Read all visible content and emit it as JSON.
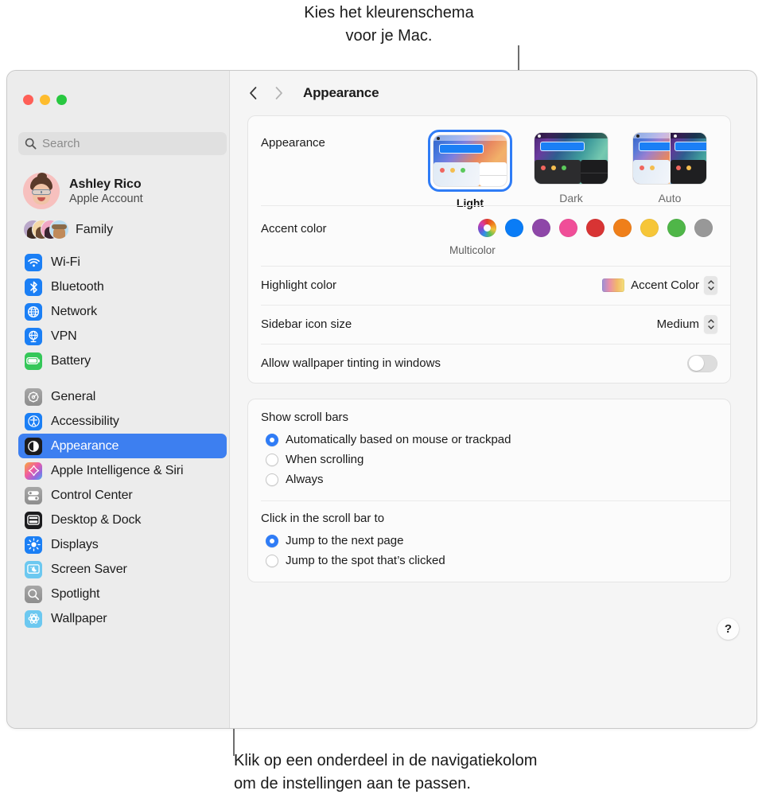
{
  "callouts": {
    "top": "Kies het kleurenschema\nvoor je Mac.",
    "bottom": "Klik op een onderdeel in de navigatiekolom\nom de instellingen aan te passen."
  },
  "window": {
    "traffic_lights": {
      "close": "close-button",
      "minimize": "minimize-button",
      "zoom": "zoom-button"
    }
  },
  "sidebar": {
    "search": {
      "placeholder": "Search",
      "value": ""
    },
    "account": {
      "name": "Ashley Rico",
      "subtitle": "Apple Account"
    },
    "family": {
      "label": "Family"
    },
    "groups": [
      {
        "items": [
          {
            "label": "Wi-Fi",
            "icon": "wifi-icon"
          },
          {
            "label": "Bluetooth",
            "icon": "bluetooth-icon"
          },
          {
            "label": "Network",
            "icon": "globe-icon"
          },
          {
            "label": "VPN",
            "icon": "vpn-globe-icon"
          },
          {
            "label": "Battery",
            "icon": "battery-icon"
          }
        ]
      },
      {
        "items": [
          {
            "label": "General",
            "icon": "gear-icon"
          },
          {
            "label": "Accessibility",
            "icon": "accessibility-icon"
          },
          {
            "label": "Appearance",
            "icon": "appearance-icon",
            "selected": true
          },
          {
            "label": "Apple Intelligence & Siri",
            "icon": "siri-icon"
          },
          {
            "label": "Control Center",
            "icon": "control-center-icon"
          },
          {
            "label": "Desktop & Dock",
            "icon": "desktop-dock-icon"
          },
          {
            "label": "Displays",
            "icon": "brightness-icon"
          },
          {
            "label": "Screen Saver",
            "icon": "screen-saver-icon"
          },
          {
            "label": "Spotlight",
            "icon": "spotlight-search-icon"
          },
          {
            "label": "Wallpaper",
            "icon": "wallpaper-icon"
          }
        ]
      }
    ]
  },
  "toolbar": {
    "back": "‹",
    "forward": "›",
    "title": "Appearance"
  },
  "main": {
    "appearance": {
      "label": "Appearance",
      "options": [
        {
          "label": "Light",
          "selected": true
        },
        {
          "label": "Dark",
          "selected": false
        },
        {
          "label": "Auto",
          "selected": false
        }
      ]
    },
    "accent_color": {
      "label": "Accent color",
      "caption": "Multicolor",
      "swatches": [
        {
          "name": "Multicolor",
          "color": "multicolor",
          "selected": true
        },
        {
          "name": "Blue",
          "color": "#0a7cf6"
        },
        {
          "name": "Purple",
          "color": "#8e47a8"
        },
        {
          "name": "Pink",
          "color": "#f04e98"
        },
        {
          "name": "Red",
          "color": "#d83434"
        },
        {
          "name": "Orange",
          "color": "#ef7f1a"
        },
        {
          "name": "Yellow",
          "color": "#f6c638"
        },
        {
          "name": "Green",
          "color": "#4fb648"
        },
        {
          "name": "Graphite",
          "color": "#989898"
        }
      ]
    },
    "highlight_color": {
      "label": "Highlight color",
      "value": "Accent Color"
    },
    "sidebar_icon_size": {
      "label": "Sidebar icon size",
      "value": "Medium"
    },
    "wallpaper_tinting": {
      "label": "Allow wallpaper tinting in windows",
      "value": "off"
    },
    "show_scroll_bars": {
      "title": "Show scroll bars",
      "options": [
        {
          "label": "Automatically based on mouse or trackpad",
          "selected": true
        },
        {
          "label": "When scrolling",
          "selected": false
        },
        {
          "label": "Always",
          "selected": false
        }
      ]
    },
    "click_scroll_bar": {
      "title": "Click in the scroll bar to",
      "options": [
        {
          "label": "Jump to the next page",
          "selected": true
        },
        {
          "label": "Jump to the spot that’s clicked",
          "selected": false
        }
      ]
    },
    "help": {
      "label": "?"
    }
  }
}
